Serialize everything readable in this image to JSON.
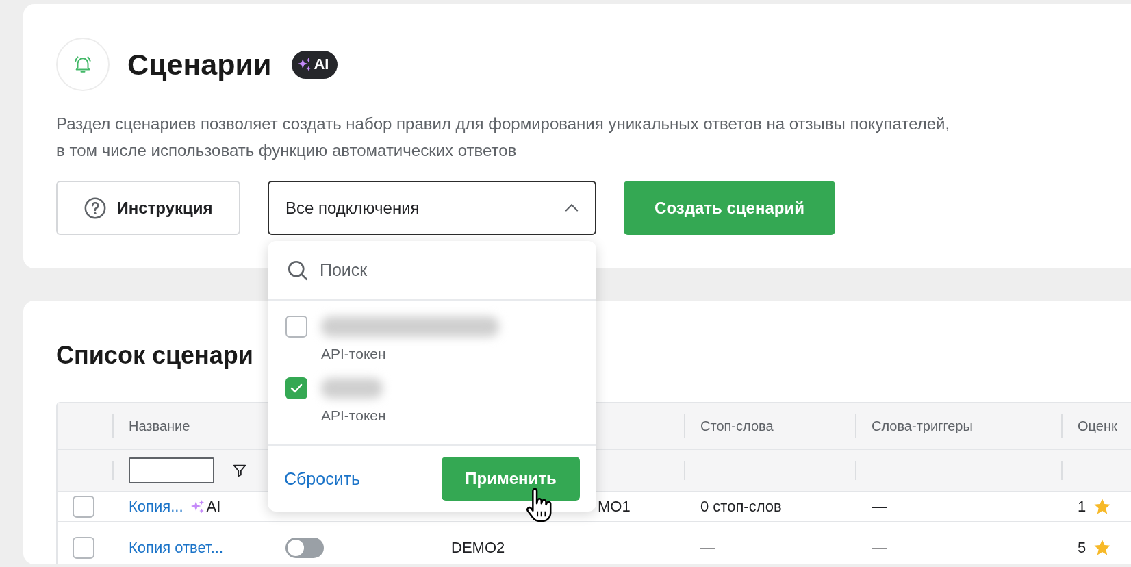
{
  "header": {
    "title": "Сценарии",
    "badge": "AI",
    "description": "Раздел сценариев позволяет создать набор правил для формирования уникальных ответов на отзывы покупателей,\nв том числе использовать функцию автоматических ответов"
  },
  "actions": {
    "help_button": "Инструкция",
    "connections_select": {
      "value": "Все подключения",
      "expanded": true
    },
    "create_button": "Создать сценарий"
  },
  "connections_dropdown": {
    "search_placeholder": "Поиск",
    "options": [
      {
        "type": "API-токен",
        "checked": false
      },
      {
        "type": "API-токен",
        "checked": true
      }
    ],
    "reset_link": "Сбросить",
    "apply_button": "Применить"
  },
  "list": {
    "title": "Список сценари",
    "columns": [
      {
        "label": "Название"
      },
      {
        "label": "Стоп-слова"
      },
      {
        "label": "Слова-триггеры"
      },
      {
        "label": "Оценк"
      }
    ],
    "rows": [
      {
        "checked": false,
        "name": "Копия...",
        "ai_badge": "AI",
        "connection": "MO1",
        "stop_words": "0 стоп-слов",
        "triggers": "—",
        "rating": "1"
      },
      {
        "checked": false,
        "name": "Копия ответ...",
        "enabled": false,
        "connection": "DEMO2",
        "stop_words": "—",
        "triggers": "—",
        "rating": "5"
      }
    ]
  }
}
